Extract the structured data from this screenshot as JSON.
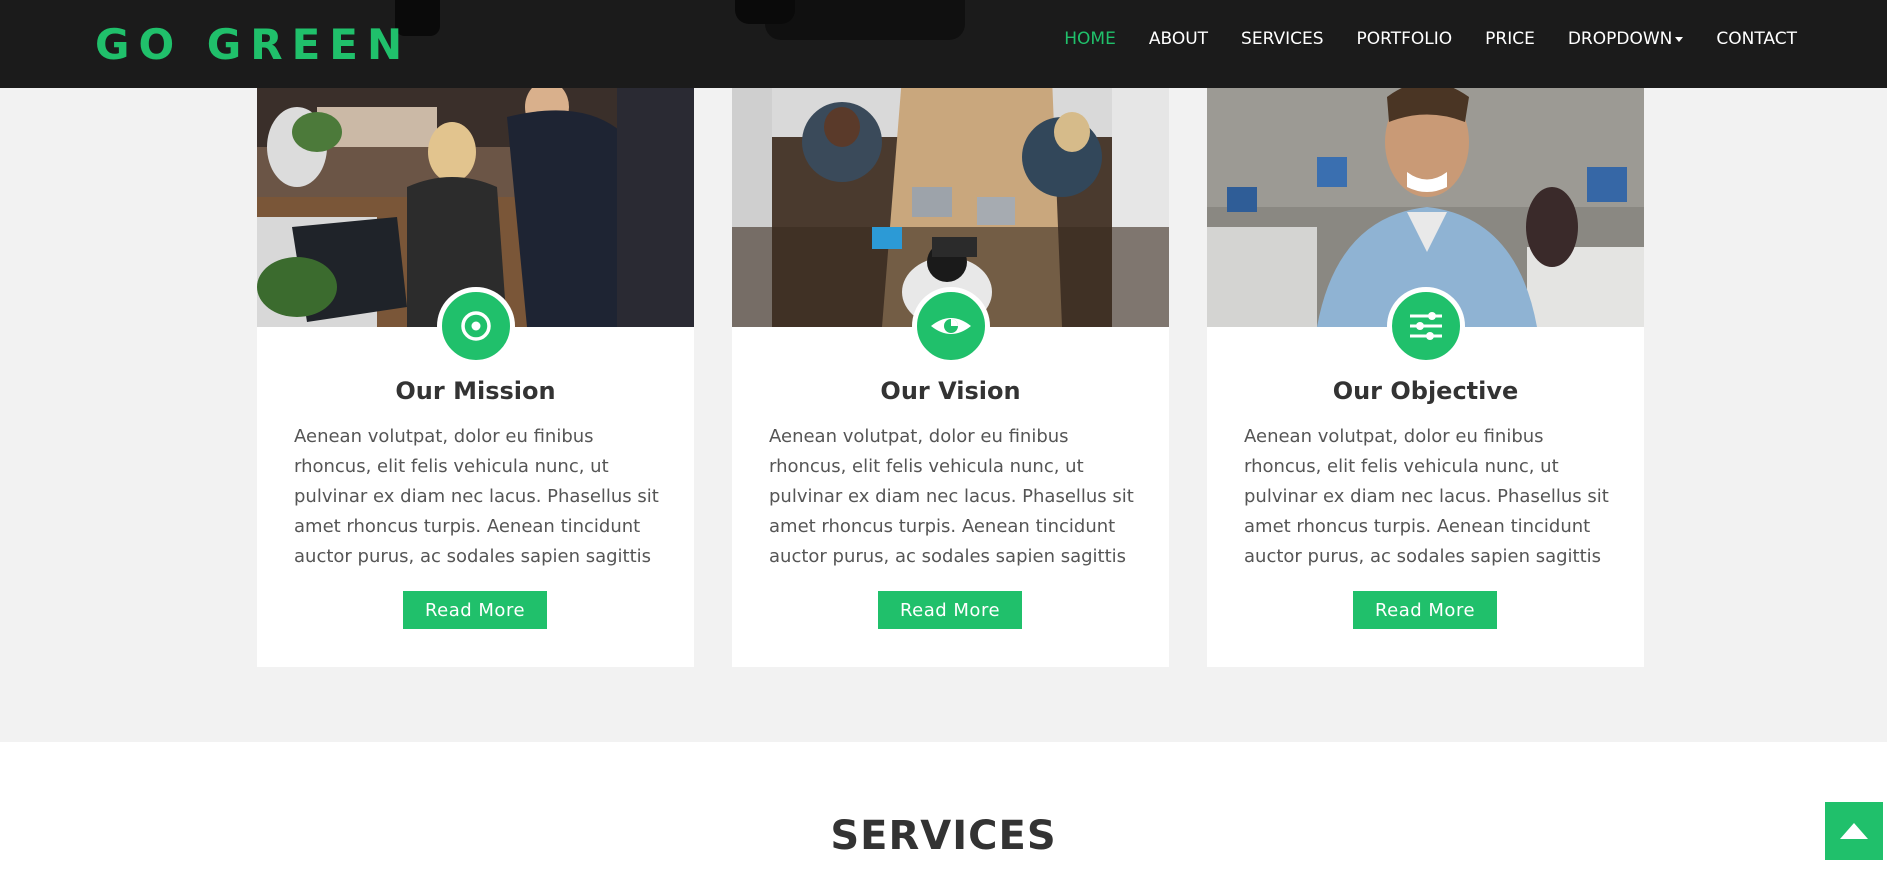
{
  "brand": {
    "name": "GO GREEN"
  },
  "nav": {
    "items": [
      {
        "label": "HOME",
        "active": true
      },
      {
        "label": "ABOUT"
      },
      {
        "label": "SERVICES"
      },
      {
        "label": "PORTFOLIO"
      },
      {
        "label": "PRICE"
      },
      {
        "label": "DROPDOWN",
        "has_caret": true
      },
      {
        "label": "CONTACT"
      }
    ]
  },
  "cards": [
    {
      "title": "Our Mission",
      "icon": "target-icon",
      "text": "Aenean volutpat, dolor eu finibus rhoncus, elit felis vehicula nunc, ut pulvinar ex diam nec lacus. Phasellus sit amet rhoncus turpis. Aenean tincidunt auctor purus, ac sodales sapien sagittis",
      "button": "Read More"
    },
    {
      "title": "Our Vision",
      "icon": "eye-icon",
      "text": "Aenean volutpat, dolor eu finibus rhoncus, elit felis vehicula nunc, ut pulvinar ex diam nec lacus. Phasellus sit amet rhoncus turpis. Aenean tincidunt auctor purus, ac sodales sapien sagittis",
      "button": "Read More"
    },
    {
      "title": "Our Objective",
      "icon": "sliders-icon",
      "text": "Aenean volutpat, dolor eu finibus rhoncus, elit felis vehicula nunc, ut pulvinar ex diam nec lacus. Phasellus sit amet rhoncus turpis. Aenean tincidunt auctor purus, ac sodales sapien sagittis",
      "button": "Read More"
    }
  ],
  "services": {
    "title": "SERVICES"
  },
  "back_to_top": {
    "icon": "arrow-up-icon"
  },
  "colors": {
    "accent": "#20c06b",
    "navbar": "#1b1b1b",
    "page_bg": "#f2f2f2"
  }
}
